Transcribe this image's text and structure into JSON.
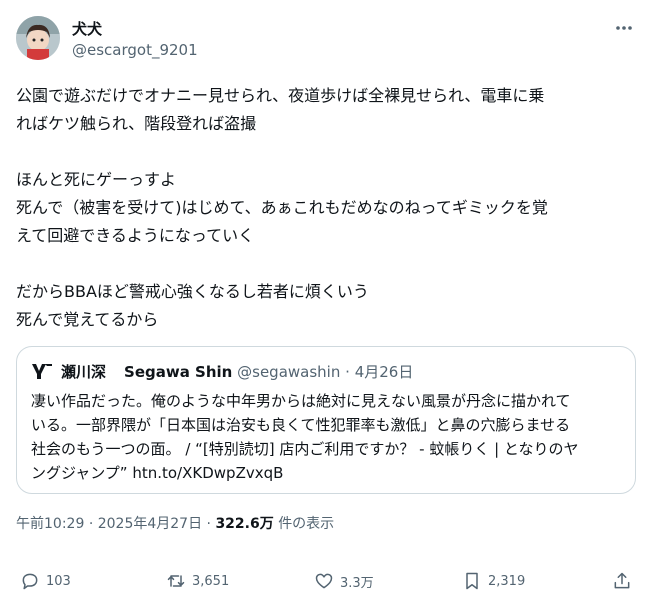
{
  "author": {
    "display_name": "犬犬",
    "handle": "@escargot_9201",
    "avatar_icon": "avatar-image",
    "more_icon": "more-horizontal-icon"
  },
  "tweet": {
    "text": "公園で遊ぶだけでオナニー見せられ、夜道歩けば全裸見せられ、電車に乗\nればケツ触られ、階段登れば盗撮\n\nほんと死にゲーっすよ\n死んで（被害を受けて)はじめて、あぁこれもだめなのねってギミックを覚\nえて回避できるようになっていく\n\nだからBBAほど警戒心強くなるし若者に煩くいう\n死んで覚えてるから"
  },
  "quote": {
    "logo_icon": "publisher-logo-icon",
    "name": "瀬川深",
    "name_en": "Segawa Shin",
    "handle": "@segawashin",
    "separator": "·",
    "date": "4月26日",
    "text": "凄い作品だった。俺のような中年男からは絶対に見えない風景が丹念に描かれて\nいる。一部界隈が「日本国は治安も良くて性犯罪率も激低」と鼻の穴膨らませる\n社会のもう一つの面。 / “[特別読切] 店内ご利用ですか？ - 蚊帳りく | となりのヤ\nングジャンプ” htn.to/XKDwpZvxqB"
  },
  "meta": {
    "time": "午前10:29",
    "dot1": "·",
    "date": "2025年4月27日",
    "dot2": "·",
    "views": "322.6万",
    "views_label": "件の表示"
  },
  "actions": {
    "replies": "103",
    "retweets": "3,651",
    "likes": "3.3万",
    "bookmarks": "2,319"
  },
  "colors": {
    "text": "#0f1419",
    "secondary": "#536471",
    "border": "#cfd9de"
  }
}
